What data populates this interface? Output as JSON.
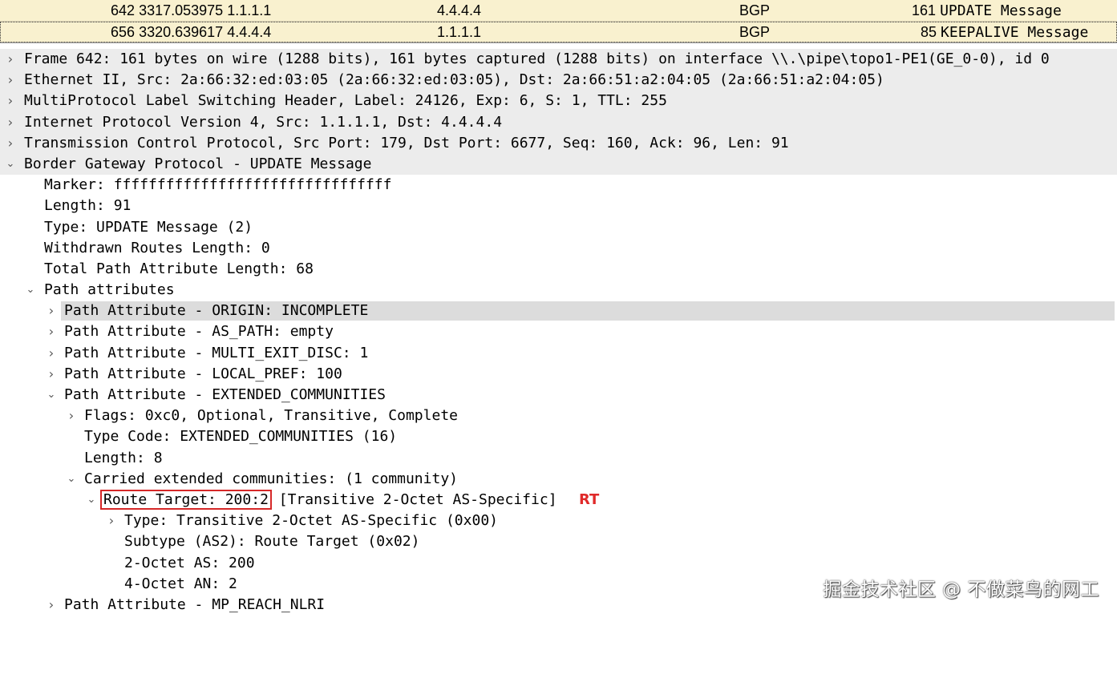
{
  "packet_list": [
    {
      "no": "642",
      "time": "3317.053975",
      "src": "1.1.1.1",
      "dst": "4.4.4.4",
      "proto": "BGP",
      "len": "161",
      "info": "UPDATE Message"
    },
    {
      "no": "656",
      "time": "3320.639617",
      "src": "4.4.4.4",
      "dst": "1.1.1.1",
      "proto": "BGP",
      "len": "85",
      "info": "KEEPALIVE Message"
    }
  ],
  "tree": {
    "frame": "Frame 642: 161 bytes on wire (1288 bits), 161 bytes captured (1288 bits) on interface \\\\.\\pipe\\topo1-PE1(GE_0-0), id 0",
    "ethernet": "Ethernet II, Src: 2a:66:32:ed:03:05 (2a:66:32:ed:03:05), Dst: 2a:66:51:a2:04:05 (2a:66:51:a2:04:05)",
    "mpls": "MultiProtocol Label Switching Header, Label: 24126, Exp: 6, S: 1, TTL: 255",
    "ip": "Internet Protocol Version 4, Src: 1.1.1.1, Dst: 4.4.4.4",
    "tcp": "Transmission Control Protocol, Src Port: 179, Dst Port: 6677, Seq: 160, Ack: 96, Len: 91",
    "bgp": "Border Gateway Protocol - UPDATE Message",
    "marker": "Marker: ffffffffffffffffffffffffffffffff",
    "length": "Length: 91",
    "type": "Type: UPDATE Message (2)",
    "withdrawn": "Withdrawn Routes Length: 0",
    "total_path": "Total Path Attribute Length: 68",
    "path_attrs": "Path attributes",
    "pa_origin": "Path Attribute - ORIGIN: INCOMPLETE",
    "pa_as_path": "Path Attribute - AS_PATH: empty",
    "pa_med": "Path Attribute - MULTI_EXIT_DISC: 1",
    "pa_local_pref": "Path Attribute - LOCAL_PREF: 100",
    "pa_ext_comm": "Path Attribute - EXTENDED_COMMUNITIES",
    "flags": "Flags: 0xc0, Optional, Transitive, Complete",
    "type_code": "Type Code: EXTENDED_COMMUNITIES (16)",
    "ext_length": "Length: 8",
    "carried": "Carried extended communities: (1 community)",
    "route_target": "Route Target: 200:2",
    "route_target_suffix": "[Transitive 2-Octet AS-Specific]",
    "rt_annotation": "RT",
    "rt_type": "Type: Transitive 2-Octet AS-Specific (0x00)",
    "rt_subtype": "Subtype (AS2): Route Target (0x02)",
    "rt_as": "2-Octet AS: 200",
    "rt_an": "4-Octet AN: 2",
    "pa_mp_reach": "Path Attribute - MP_REACH_NLRI"
  },
  "watermark": "掘金技术社区 @ 不做菜鸟的网工",
  "icons": {
    "collapsed": "chevron-right-icon",
    "expanded": "chevron-down-icon"
  },
  "colors": {
    "packet_row_bg": "#f9f1cf",
    "header_row_bg": "#ececec",
    "selected_row_bg": "#dcdcdc",
    "highlight_box": "#d62828",
    "annotation": "#e02a2a"
  }
}
